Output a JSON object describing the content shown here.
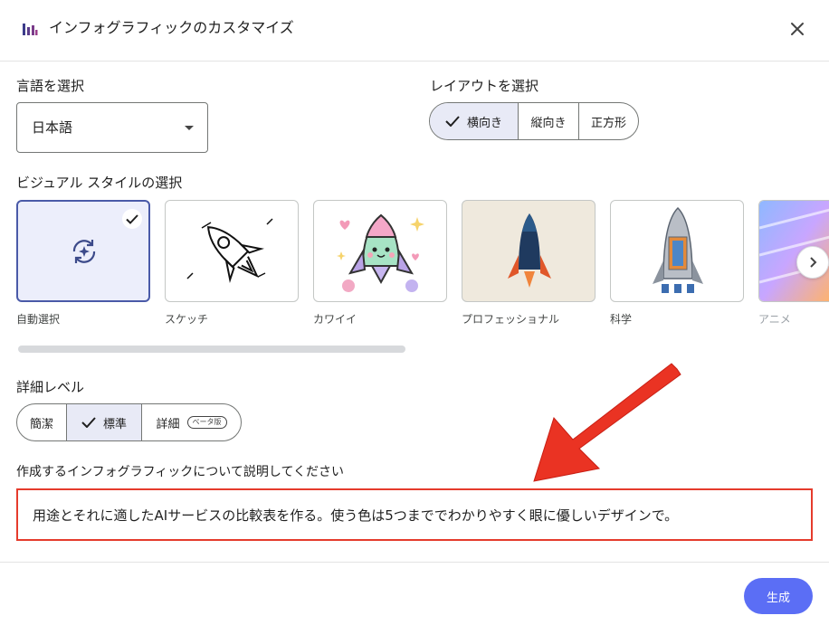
{
  "header": {
    "title": "インフォグラフィックのカスタマイズ",
    "logo_icon": "bar-chart-icon",
    "close_icon": "close-icon"
  },
  "language": {
    "label": "言語を選択",
    "value": "日本語"
  },
  "layout": {
    "label": "レイアウトを選択",
    "options": [
      "横向き",
      "縦向き",
      "正方形"
    ],
    "selected": "横向き"
  },
  "visual_style": {
    "label": "ビジュアル スタイルの選択",
    "options": [
      "自動選択",
      "スケッチ",
      "カワイイ",
      "プロフェッショナル",
      "科学",
      "アニメ"
    ],
    "selected": "自動選択"
  },
  "detail": {
    "label": "詳細レベル",
    "options": [
      "簡潔",
      "標準",
      "詳細"
    ],
    "beta_badge": "ベータ版",
    "selected": "標準"
  },
  "description": {
    "label": "作成するインフォグラフィックについて説明してください",
    "value": "用途とそれに適したAIサービスの比較表を作る。使う色は5つまででわかりやすく眼に優しいデザインで。"
  },
  "generate_label": "生成",
  "colors": {
    "accent": "#5b6ef5",
    "selected_bg": "#e8eaf6",
    "highlight": "#e53b2c"
  }
}
